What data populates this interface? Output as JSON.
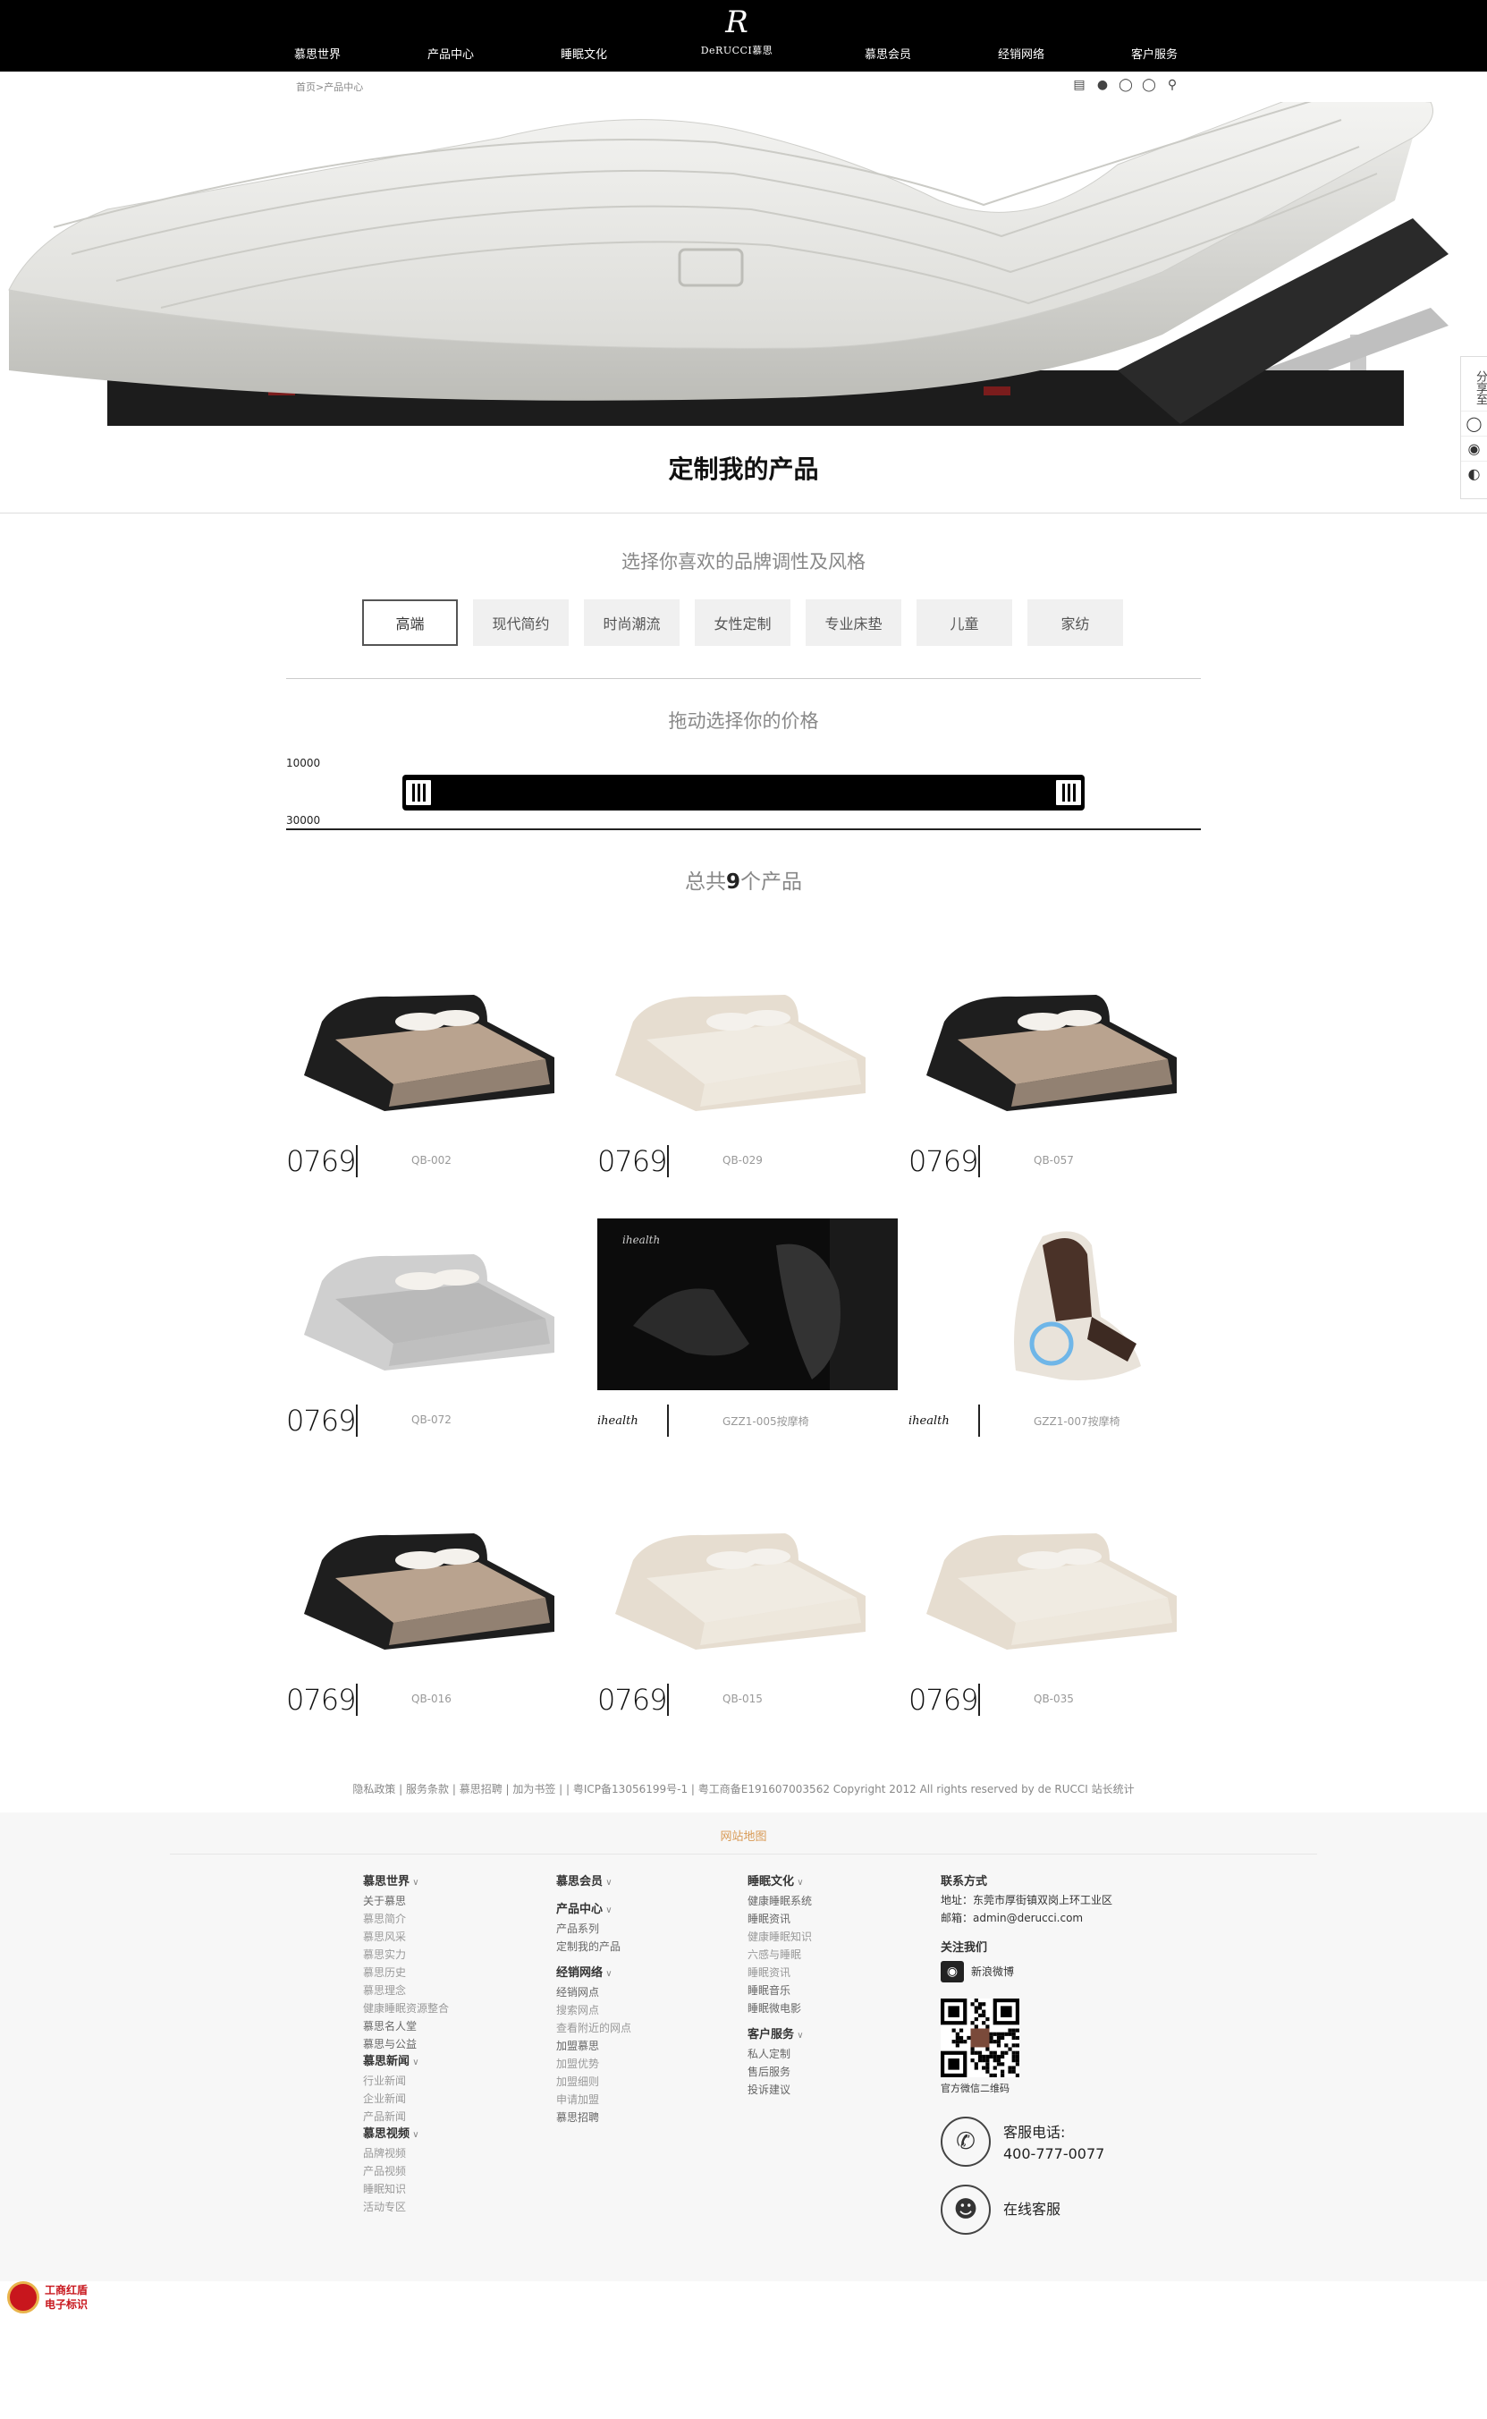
{
  "nav": {
    "items": [
      "慕思世界",
      "产品中心",
      "睡眠文化",
      "慕思会员",
      "经销网络",
      "客户服务"
    ],
    "logo_monogram": "R",
    "logo_word": "DeRUCCI慕思"
  },
  "breadcrumb": "首页>产品中心",
  "tools": [
    "chat-icon",
    "user-icon",
    "globe-icon",
    "globe2-icon",
    "search-icon"
  ],
  "share": {
    "label": "分享至"
  },
  "page_title": "定制我的产品",
  "style_section": {
    "title": "选择你喜欢的品牌调性及风格",
    "options": [
      "高端",
      "现代简约",
      "时尚潮流",
      "女性定制",
      "专业床垫",
      "儿童",
      "家纺"
    ],
    "selected": "高端"
  },
  "price_section": {
    "title": "拖动选择你的价格",
    "min_label": "10000",
    "max_label": "30000",
    "range_low": 0,
    "range_high": 1
  },
  "total": {
    "prefix": "总共",
    "count": "9",
    "suffix": "个产品"
  },
  "products": [
    {
      "brand": "0769",
      "code": "QB-002",
      "kind": "bed-dark"
    },
    {
      "brand": "0769",
      "code": "QB-029",
      "kind": "bed-cream"
    },
    {
      "brand": "0769",
      "code": "QB-057",
      "kind": "bed-dark"
    },
    {
      "brand": "0769",
      "code": "QB-072",
      "kind": "bed-grey"
    },
    {
      "brand": "ihealth",
      "code": "GZZ1-005按摩椅",
      "kind": "chair-dark"
    },
    {
      "brand": "ihealth",
      "code": "GZZ1-007按摩椅",
      "kind": "chair-light"
    },
    {
      "brand": "0769",
      "code": "QB-016",
      "kind": "bed-dark"
    },
    {
      "brand": "0769",
      "code": "QB-015",
      "kind": "bed-cream"
    },
    {
      "brand": "0769",
      "code": "QB-035",
      "kind": "bed-cream"
    }
  ],
  "footer_links": "隐私政策 | 服务条款 | 慕思招聘 | 加为书签 | | 粤ICP备13056199号-1 | 粤工商备E191607003562 Copyright 2012 All rights reserved by de RUCCI 站长统计",
  "sitemap": {
    "title": "网站地图",
    "col1": [
      {
        "t": "h",
        "v": "慕思世界"
      },
      {
        "t": "d",
        "v": "关于慕思"
      },
      {
        "t": "l",
        "v": "慕思简介"
      },
      {
        "t": "l",
        "v": "慕思风采"
      },
      {
        "t": "l",
        "v": "慕思实力"
      },
      {
        "t": "l",
        "v": "慕思历史"
      },
      {
        "t": "l",
        "v": "慕思理念"
      },
      {
        "t": "l",
        "v": "健康睡眠资源整合"
      },
      {
        "t": "d",
        "v": "慕思名人堂"
      },
      {
        "t": "d",
        "v": "慕思与公益"
      },
      {
        "t": "h",
        "v": "慕思新闻"
      },
      {
        "t": "l",
        "v": "行业新闻"
      },
      {
        "t": "l",
        "v": "企业新闻"
      },
      {
        "t": "l",
        "v": "产品新闻"
      },
      {
        "t": "h",
        "v": "慕思视频"
      },
      {
        "t": "l",
        "v": "品牌视频"
      },
      {
        "t": "l",
        "v": "产品视频"
      },
      {
        "t": "l",
        "v": "睡眠知识"
      },
      {
        "t": "l",
        "v": "活动专区"
      }
    ],
    "col2": [
      {
        "t": "h",
        "v": "慕思会员"
      },
      {
        "t": "g",
        "v": ""
      },
      {
        "t": "h",
        "v": "产品中心"
      },
      {
        "t": "d",
        "v": "产品系列"
      },
      {
        "t": "d",
        "v": "定制我的产品"
      },
      {
        "t": "g",
        "v": ""
      },
      {
        "t": "h",
        "v": "经销网络"
      },
      {
        "t": "d",
        "v": "经销网点"
      },
      {
        "t": "l",
        "v": "搜索网点"
      },
      {
        "t": "l",
        "v": "查看附近的网点"
      },
      {
        "t": "d",
        "v": "加盟慕思"
      },
      {
        "t": "l",
        "v": "加盟优势"
      },
      {
        "t": "l",
        "v": "加盟细则"
      },
      {
        "t": "l",
        "v": "申请加盟"
      },
      {
        "t": "d",
        "v": "慕思招聘"
      }
    ],
    "col3": [
      {
        "t": "h",
        "v": "睡眠文化"
      },
      {
        "t": "d",
        "v": "健康睡眠系统"
      },
      {
        "t": "d",
        "v": "睡眠资讯"
      },
      {
        "t": "l",
        "v": "健康睡眠知识"
      },
      {
        "t": "l",
        "v": "六感与睡眠"
      },
      {
        "t": "l",
        "v": "睡眠资讯"
      },
      {
        "t": "d",
        "v": "睡眠音乐"
      },
      {
        "t": "d",
        "v": "睡眠微电影"
      },
      {
        "t": "g",
        "v": ""
      },
      {
        "t": "h",
        "v": "客户服务"
      },
      {
        "t": "d",
        "v": "私人定制"
      },
      {
        "t": "d",
        "v": "售后服务"
      },
      {
        "t": "d",
        "v": "投诉建议"
      }
    ]
  },
  "contact": {
    "title": "联系方式",
    "address": "地址：东莞市厚街镇双岗上环工业区",
    "email": "邮箱：admin@derucci.com",
    "follow": "关注我们",
    "weibo": "新浪微博",
    "qr_caption": "官方微信二维码",
    "phone_label": "客服电话:",
    "phone": "400-777-0077",
    "online": "在线客服"
  },
  "badge": {
    "line1": "工商红盾",
    "line2": "电子标识"
  },
  "colors": {
    "nav_bg": "#000000",
    "accent": "#d89a55",
    "footer_bg": "#f7f7f7"
  }
}
